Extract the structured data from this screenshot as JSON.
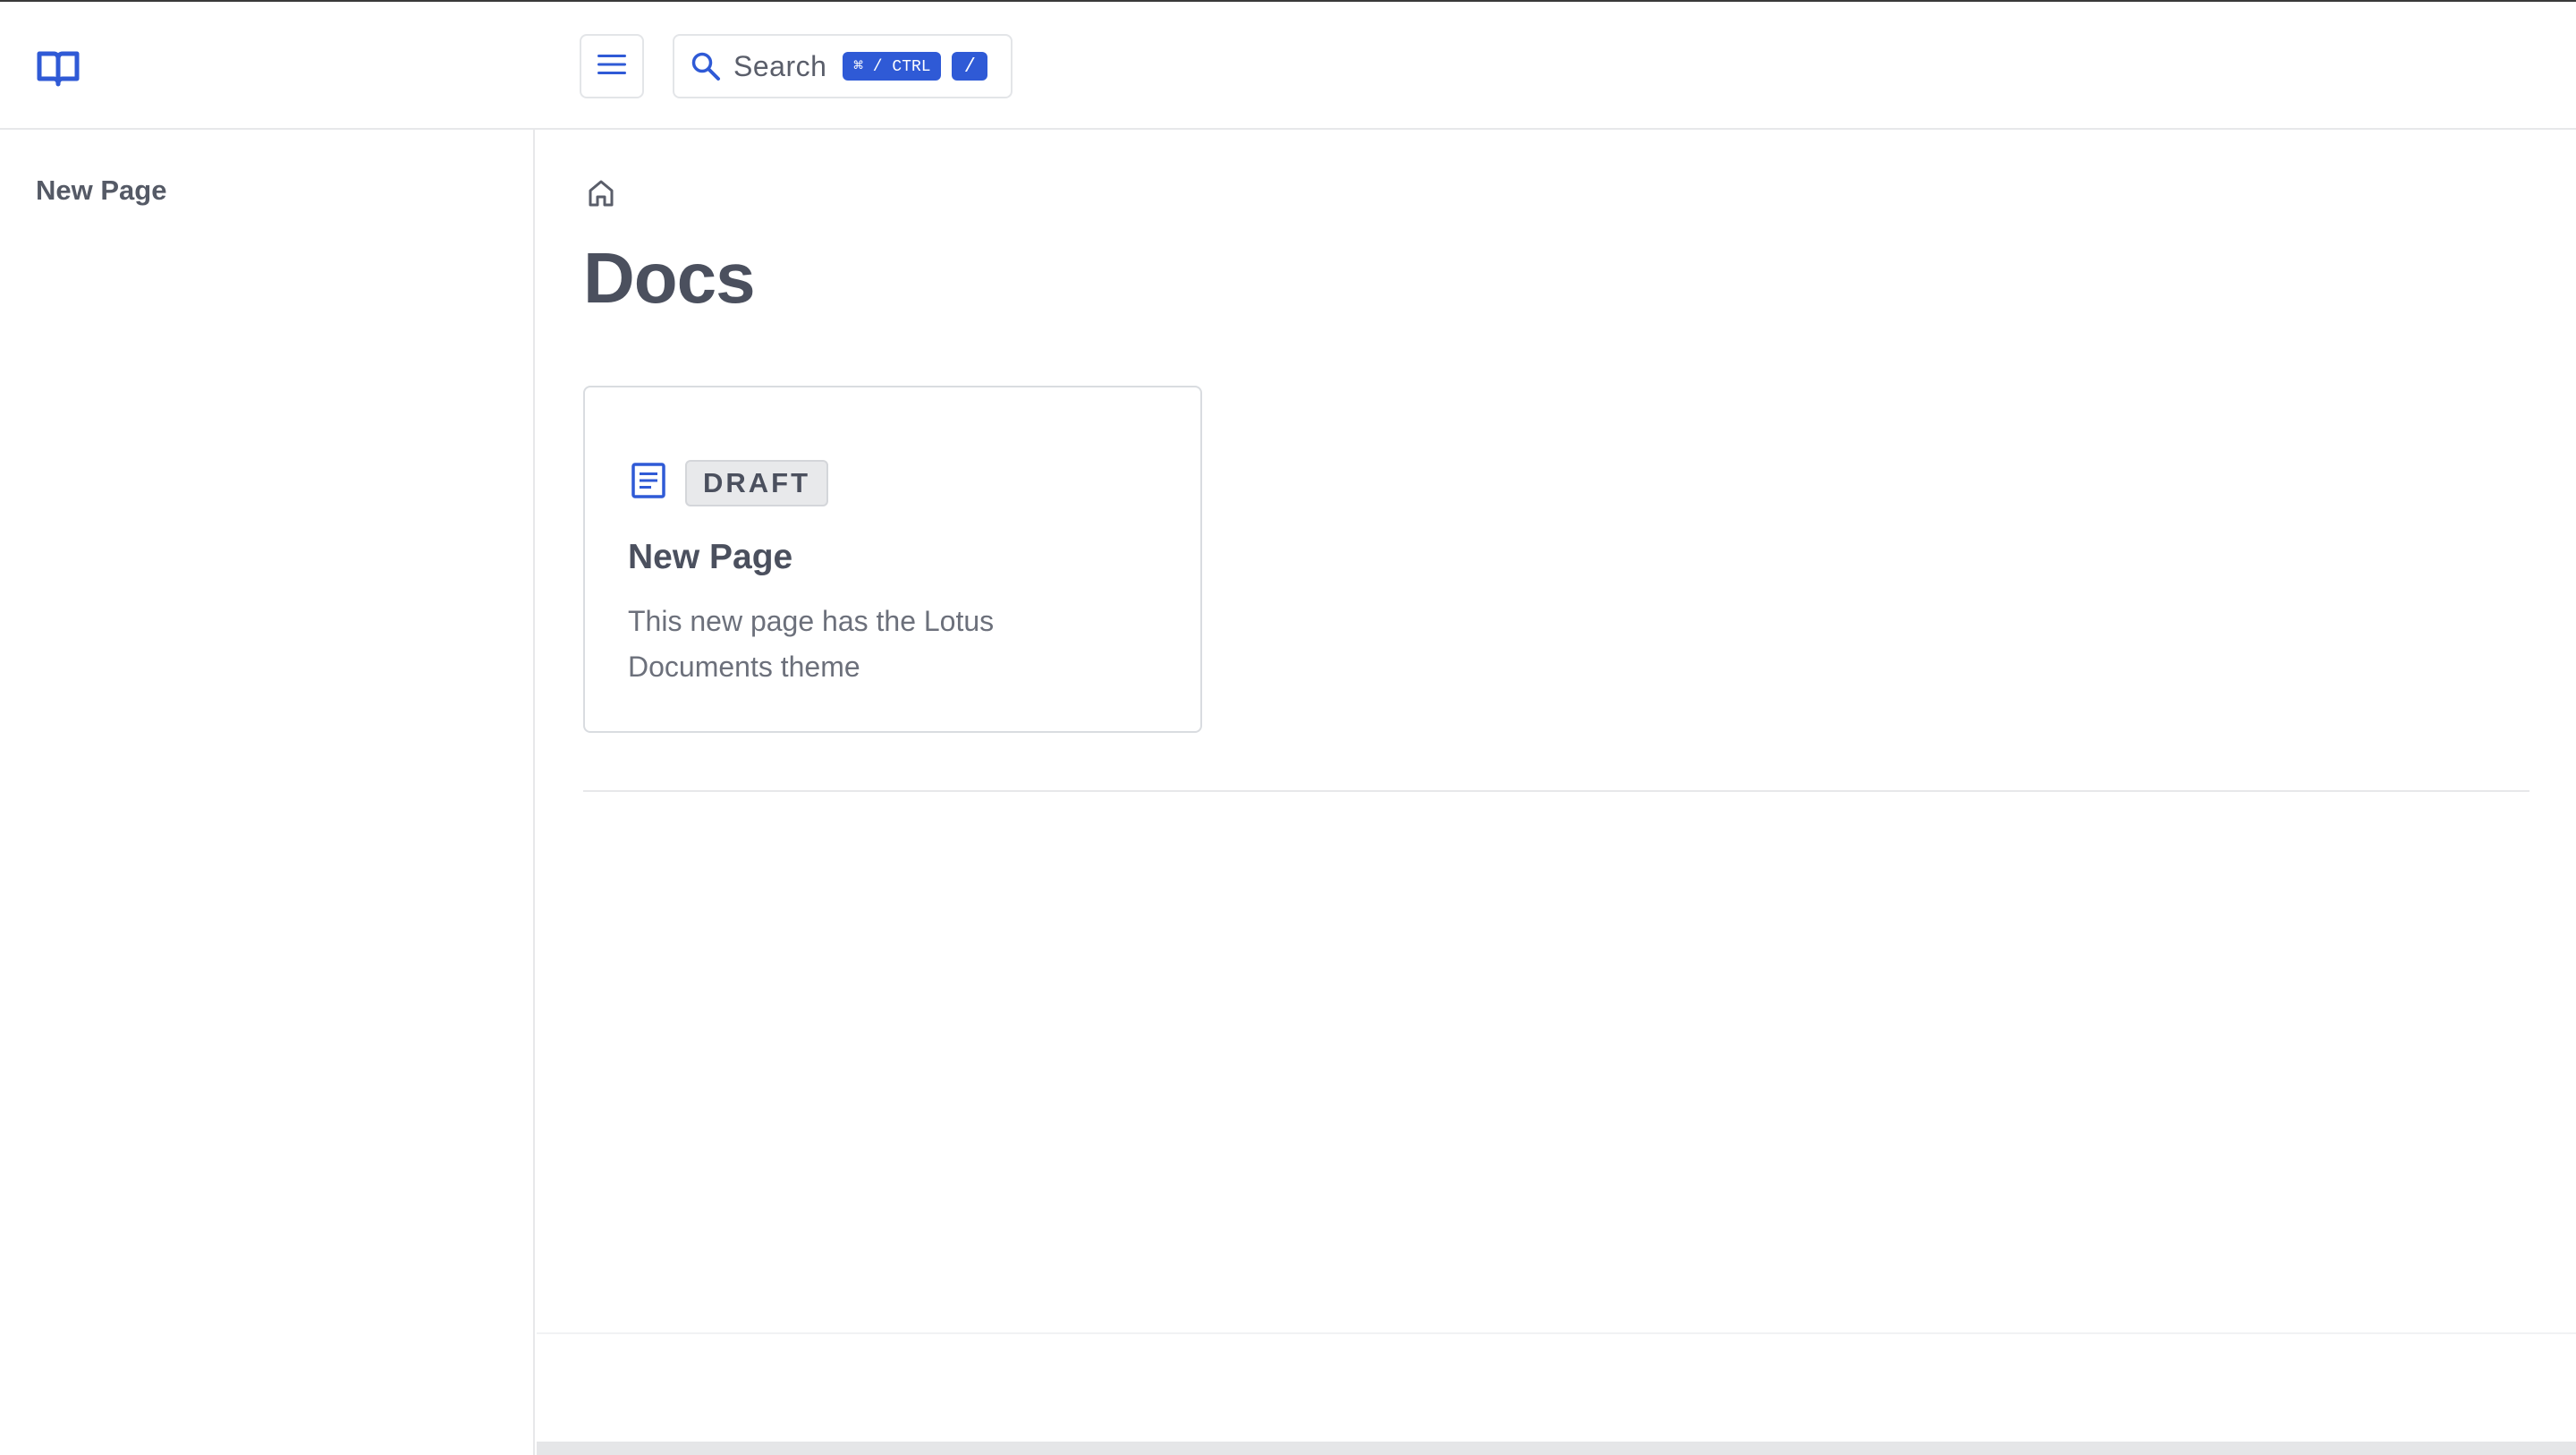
{
  "header": {
    "logo_icon": "book-open-icon",
    "menu_icon": "hamburger-menu-icon",
    "search": {
      "icon": "search-icon",
      "label": "Search",
      "shortcut_modifier": "⌘ / CTRL",
      "shortcut_key": "/"
    },
    "accent_color": "#2f5ad6"
  },
  "sidebar": {
    "items": [
      {
        "label": "New Page"
      }
    ]
  },
  "main": {
    "breadcrumb_icon": "home-icon",
    "title": "Docs",
    "cards": [
      {
        "icon": "document-icon",
        "badge": "DRAFT",
        "title": "New Page",
        "description": "This new page has the Lotus Documents theme"
      }
    ]
  }
}
